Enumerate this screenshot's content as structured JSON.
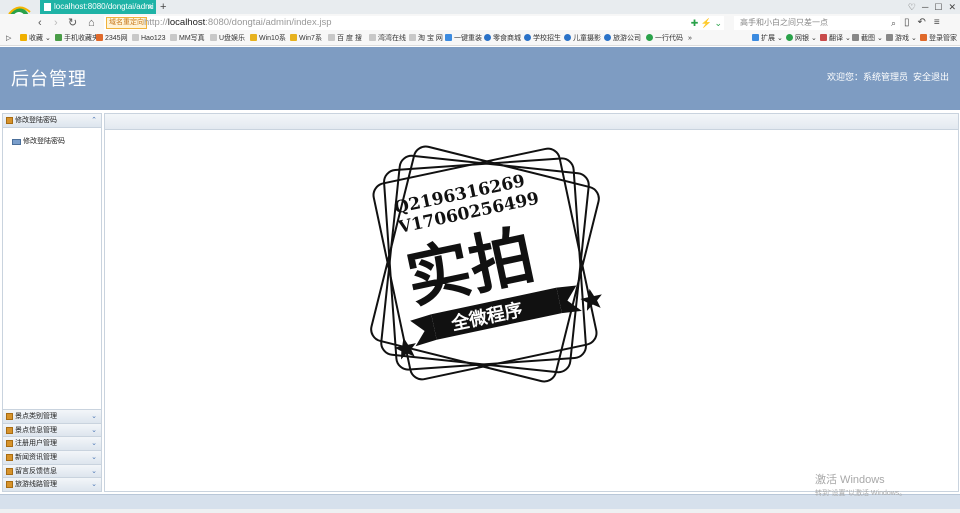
{
  "browser": {
    "tab_title": "localhost:8080/dongtai/admi",
    "url_tag": "域名重定向",
    "url_prefix": "http://",
    "url_host": "localhost",
    "url_rest": ":8080/dongtai/admin/index.jsp",
    "search_placeholder": "高手和小白之间只差一点",
    "favorites": [
      "收藏",
      "手机收藏夹",
      "2345网",
      "Hao123",
      "MM写真",
      "U盘娱乐",
      "Win10系",
      "Win7系",
      "百 度 搜",
      "湾湾在线",
      "淘 宝 网",
      "一键重装",
      "零食商城",
      "学校招生",
      "儿童摄影",
      "旅游公司",
      "一行代码"
    ],
    "right_tools": [
      "扩展",
      "网银",
      "翻译",
      "截图",
      "游戏",
      "登录管家"
    ]
  },
  "header": {
    "title": "后台管理",
    "welcome": "欢迎您：系统管理员",
    "logout": "安全退出"
  },
  "sidebar": {
    "open_panel": {
      "title": "修改登陆密码",
      "items": [
        "修改登陆密码"
      ]
    },
    "collapsed_panels": [
      "景点类别管理",
      "景点信息管理",
      "注册用户管理",
      "新闻资讯管理",
      "留言反馈信息",
      "旅游线路管理"
    ]
  },
  "stamp": {
    "line1": "Q2196316269",
    "line2": "V17060256499",
    "main": "实拍",
    "banner": "全微程序"
  },
  "watermark": {
    "line1": "激活 Windows",
    "line2": "转到\"设置\"以激活 Windows。"
  },
  "colors": {
    "header_bg": "#7e9cc2",
    "tab_active": "#1fb3a6"
  }
}
